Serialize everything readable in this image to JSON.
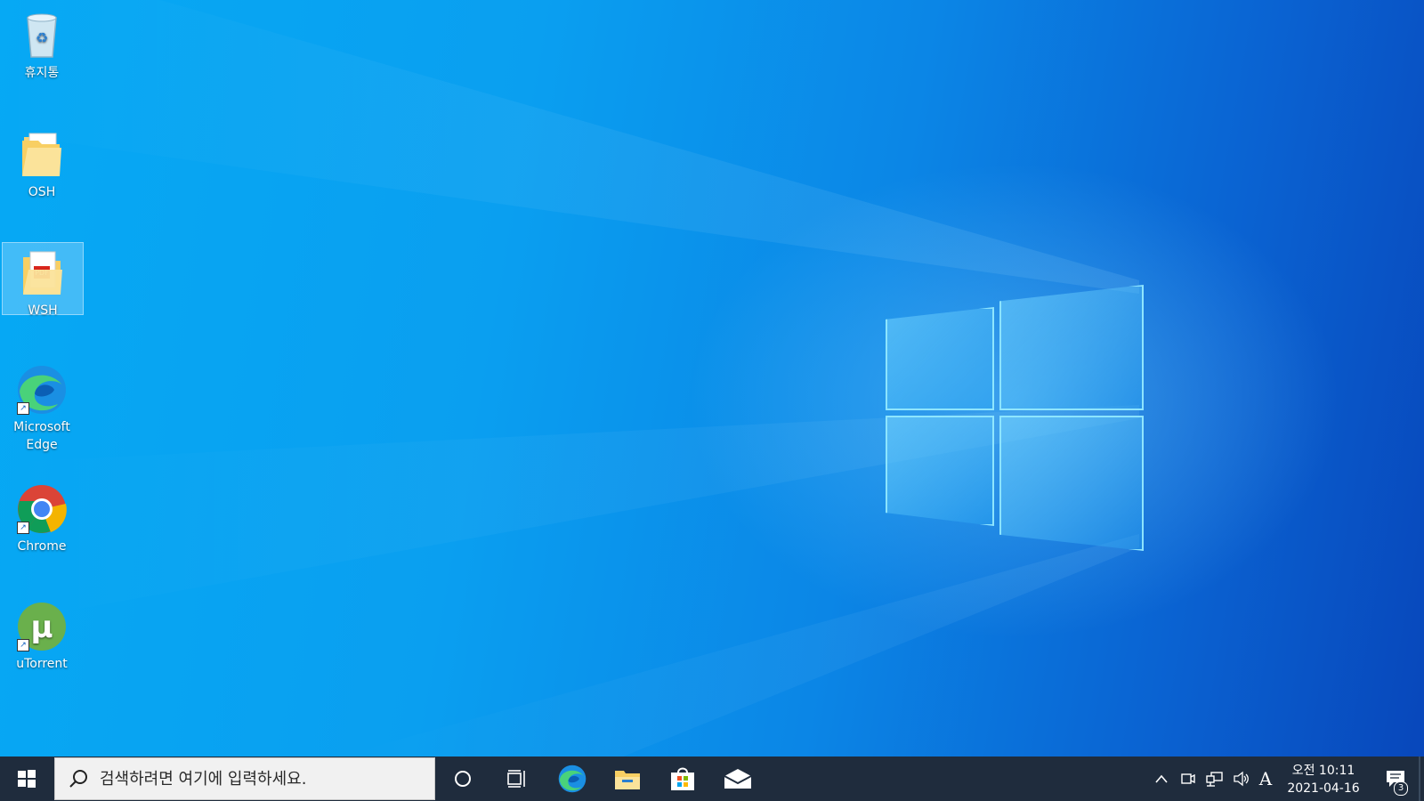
{
  "desktop": {
    "icons": [
      {
        "label": "휴지통",
        "icon": "recycle-bin-icon"
      },
      {
        "label": "OSH",
        "icon": "folder-icon"
      },
      {
        "label": "WSH",
        "icon": "pdf-folder-icon",
        "selected": true
      },
      {
        "label": "Microsoft Edge",
        "icon": "edge-icon"
      },
      {
        "label": "Chrome",
        "icon": "chrome-icon"
      },
      {
        "label": "uTorrent",
        "icon": "utorrent-icon"
      }
    ]
  },
  "taskbar": {
    "search_placeholder": "검색하려면 여기에 입력하세요.",
    "pinned": [
      "start-icon",
      "cortana-icon",
      "task-view-icon",
      "edge-icon",
      "file-explorer-icon",
      "store-icon",
      "mail-icon"
    ],
    "tray": {
      "input_indicator": "A",
      "time": "오전 10:11",
      "date": "2021-04-16",
      "notification_count": "3"
    }
  },
  "colors": {
    "taskbar_bg": "#1f2c3d",
    "desktop_blue": "#0a9ff0",
    "selection": "#b4e1ff"
  }
}
